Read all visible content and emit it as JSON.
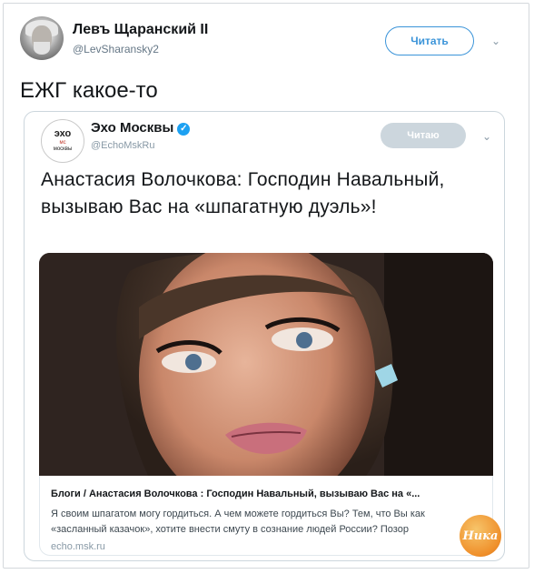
{
  "tweet": {
    "author_name": "Левъ Щаранский II",
    "author_handle": "@LevSharansky2",
    "follow_label": "Читать",
    "text": "ЕЖГ какое-то"
  },
  "quoted": {
    "logo_line1": "эхо",
    "logo_line2": "мс",
    "logo_line3": "москвы",
    "author_name": "Эхо Москвы",
    "author_handle": "@EchoMskRu",
    "follow_label": "Читаю",
    "headline": "Анастасия Волочкова: Господин Навальный, вызываю Вас на «шпагатную дуэль»!",
    "card": {
      "title": "Блоги / Анастасия Волочкова : Господин Навальный, вызываю Вас на «...",
      "description": "Я своим шпагатом могу гордиться. А чем можете гордиться Вы? Тем, что Вы как «засланный казачок», хотите внести смуту в сознание людей России? Позор",
      "domain": "echo.msk.ru"
    }
  },
  "watermark": "Ника",
  "icons": {
    "chevron": "chevron-down-icon",
    "verified": "verified-badge-icon"
  },
  "colors": {
    "accent": "#3b94d9",
    "verified": "#1da1f2"
  }
}
